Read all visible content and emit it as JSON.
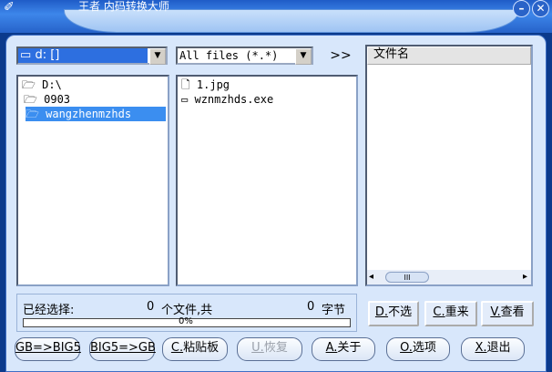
{
  "window": {
    "title": "王者 内码转换大师",
    "app_icon": "app-logo-icon"
  },
  "toolbar": {
    "drive_value": "d: []",
    "filter_value": "All files (*.*)",
    "forward_label": ">>"
  },
  "folders": {
    "items": [
      "D:\\",
      "0903",
      "wangzhenmzhds"
    ]
  },
  "files": {
    "items": [
      "1.jpg",
      "wznmzhds.exe"
    ]
  },
  "queue": {
    "column_header": "文件名"
  },
  "status": {
    "prefix": "已经选择:",
    "file_count": "0",
    "file_unit": "个文件,共",
    "byte_count": "0",
    "byte_unit": "字节",
    "progress_text": "0%",
    "progress_fraction": 0
  },
  "side_buttons": [
    {
      "key": "D.",
      "label": "不选"
    },
    {
      "key": "C.",
      "label": "重来"
    },
    {
      "key": "V.",
      "label": "查看"
    }
  ],
  "bottom_buttons": [
    {
      "key": "GB=>BIG5",
      "label": ""
    },
    {
      "key": "BIG5=>GB",
      "label": ""
    },
    {
      "key": "C.",
      "label": "粘贴板"
    },
    {
      "key": "U.",
      "label": "恢复"
    },
    {
      "key": "A.",
      "label": "关于"
    },
    {
      "key": "O.",
      "label": "选项"
    },
    {
      "key": "X.",
      "label": "退出"
    }
  ],
  "scrollbar": {
    "thumb_label": "III"
  }
}
